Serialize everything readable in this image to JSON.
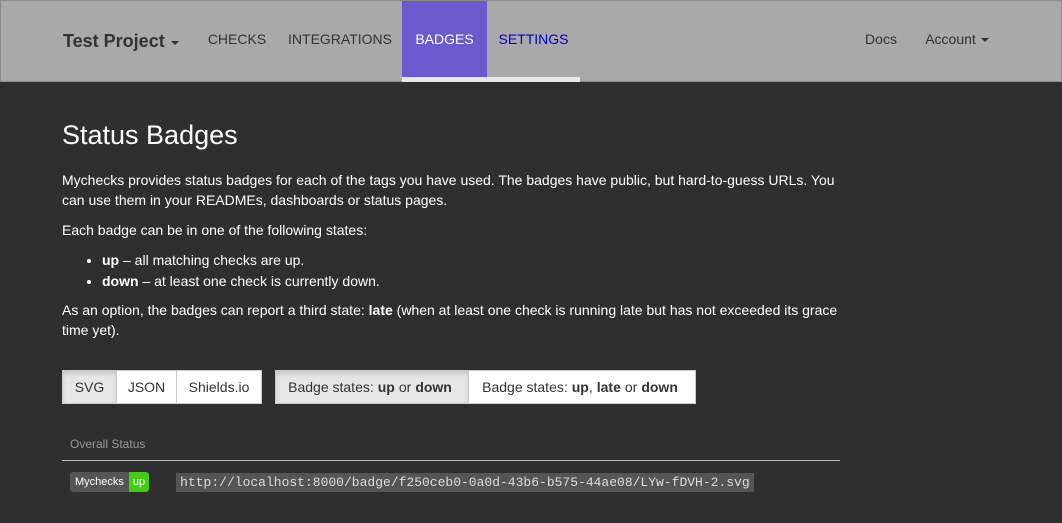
{
  "navbar": {
    "brand": "Test Project",
    "items": [
      {
        "label": "CHECKS"
      },
      {
        "label": "INTEGRATIONS"
      },
      {
        "label": "BADGES"
      },
      {
        "label": "SETTINGS"
      }
    ],
    "docs": "Docs",
    "account": "Account"
  },
  "page": {
    "title": "Status Badges",
    "p1": "Mychecks provides status badges for each of the tags you have used. The badges have public, but hard-to-guess URLs. You can use them in your READMEs, dashboards or status pages.",
    "p2": "Each badge can be in one of the following states:",
    "states": [
      {
        "name": "up",
        "desc": " – all matching checks are up."
      },
      {
        "name": "down",
        "desc": " – at least one check is currently down."
      }
    ],
    "p3_pre": "As an option, the badges can report a third state: ",
    "p3_bold": "late",
    "p3_post": " (when at least one check is running late but has not exceeded its grace time yet)."
  },
  "formats": [
    "SVG",
    "JSON",
    "Shields.io"
  ],
  "state_options": {
    "two": {
      "prefix": "Badge states:",
      "a": "up",
      "or": "or",
      "b": "down"
    },
    "three": {
      "prefix": "Badge states:",
      "a": "up",
      "comma": ",",
      "b": "late",
      "or": "or",
      "c": "down"
    }
  },
  "table": {
    "header": "Overall Status",
    "rows": [
      {
        "badge_label": "Mychecks",
        "badge_status": "up",
        "url": "http://localhost:8000/badge/f250ceb0-0a0d-43b6-b575-44ae08/LYw-fDVH-2.svg"
      }
    ]
  },
  "colors": {
    "navbar_bg": "#a9a9a9",
    "active_tab": "#6a5acd",
    "page_bg": "#2f2f2f",
    "badge_up": "#44cc11"
  }
}
